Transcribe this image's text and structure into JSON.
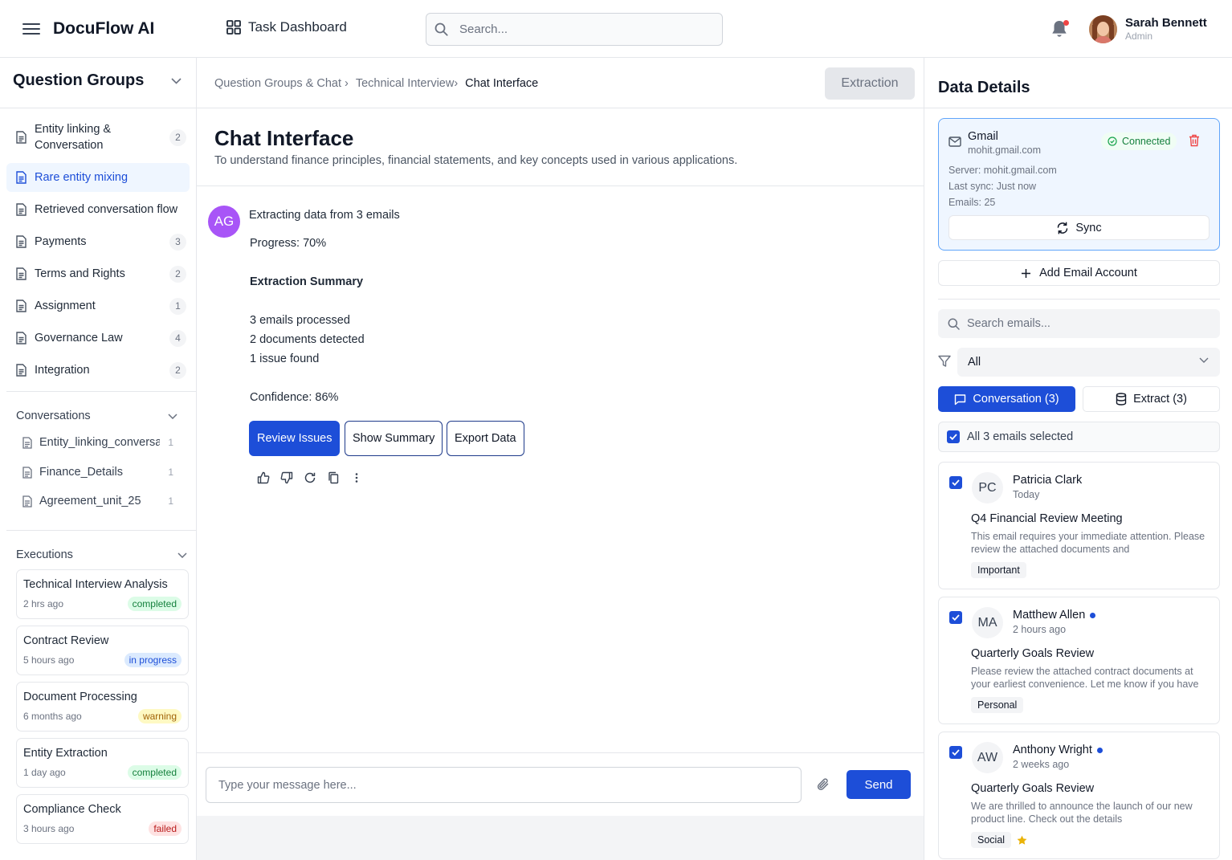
{
  "header": {
    "app_name": "DocuFlow AI",
    "nav_title": "Task Dashboard",
    "search_placeholder": "Search...",
    "user": {
      "name": "Sarah Bennett",
      "role": "Admin"
    }
  },
  "sidebar": {
    "title": "Question Groups",
    "question_groups": [
      {
        "label": "Entity linking & Conversation",
        "count": "2"
      },
      {
        "label": "Rare entity mixing",
        "count": "",
        "active": true
      },
      {
        "label": "Retrieved conversation flow",
        "count": ""
      },
      {
        "label": "Payments",
        "count": "3"
      },
      {
        "label": "Terms and Rights",
        "count": "2"
      },
      {
        "label": "Assignment",
        "count": "1"
      },
      {
        "label": "Governance Law",
        "count": "4"
      },
      {
        "label": "Integration",
        "count": "2"
      }
    ],
    "conversations": {
      "title": "Conversations",
      "items": [
        {
          "label": "Entity_linking_conversation",
          "count": "1"
        },
        {
          "label": "Finance_Details",
          "count": "1"
        },
        {
          "label": "Agreement_unit_25",
          "count": "1"
        }
      ]
    },
    "executions": {
      "title": "Executions",
      "items": [
        {
          "name": "Technical Interview Analysis",
          "time": "2 hrs ago",
          "status": "completed"
        },
        {
          "name": "Contract Review",
          "time": "5 hours ago",
          "status": "in progress"
        },
        {
          "name": "Document Processing",
          "time": "6 months ago",
          "status": "warning"
        },
        {
          "name": "Entity Extraction",
          "time": "1 day ago",
          "status": "completed"
        },
        {
          "name": "Compliance Check",
          "time": "3 hours ago",
          "status": "failed"
        }
      ]
    }
  },
  "main": {
    "breadcrumb": [
      "Question Groups & Chat",
      "Technical Interview",
      "Chat Interface"
    ],
    "extraction_button": "Extraction",
    "title": "Chat Interface",
    "subtitle": "To understand finance principles, financial statements, and key concepts used in various applications.",
    "message": {
      "avatar": "AG",
      "header": "Extracting data from 3 emails",
      "progress": "Progress: 70%",
      "summary_title": "Extraction Summary",
      "lines": [
        "3 emails processed",
        "2 documents detected",
        "1 issue found"
      ],
      "confidence": "Confidence: 86%",
      "actions": [
        "Review Issues",
        "Show Summary",
        "Export Data"
      ]
    },
    "composer": {
      "placeholder": "Type your message here...",
      "send_label": "Send"
    }
  },
  "right_panel": {
    "title": "Data Details",
    "account": {
      "provider": "Gmail",
      "address": "mohit.gmail.com",
      "status": "Connected",
      "server": "Server: mohit.gmail.com",
      "last_sync": "Last sync: Just now",
      "emails": "Emails: 25",
      "sync_label": "Sync"
    },
    "add_account_label": "Add Email Account",
    "search_placeholder": "Search emails...",
    "filter_value": "All",
    "tabs": [
      "Conversation (3)",
      "Extract (3)"
    ],
    "select_all_label": "All 3 emails selected",
    "emails": [
      {
        "initials": "PC",
        "sender": "Patricia Clark",
        "time": "Today",
        "unread": false,
        "subject": "Q4 Financial Review Meeting",
        "preview": "This email requires your immediate attention. Please review the attached documents and",
        "tag": "Important",
        "starred": false
      },
      {
        "initials": "MA",
        "sender": "Matthew Allen",
        "time": "2 hours ago",
        "unread": true,
        "subject": "Quarterly Goals Review",
        "preview": "Please review the attached contract documents at your earliest convenience. Let me know if you have",
        "tag": "Personal",
        "starred": false
      },
      {
        "initials": "AW",
        "sender": "Anthony Wright",
        "time": "2 weeks ago",
        "unread": true,
        "subject": "Quarterly Goals Review",
        "preview": "We are thrilled to announce the launch of our new product line. Check out the details",
        "tag": "Social",
        "starred": true
      }
    ]
  }
}
